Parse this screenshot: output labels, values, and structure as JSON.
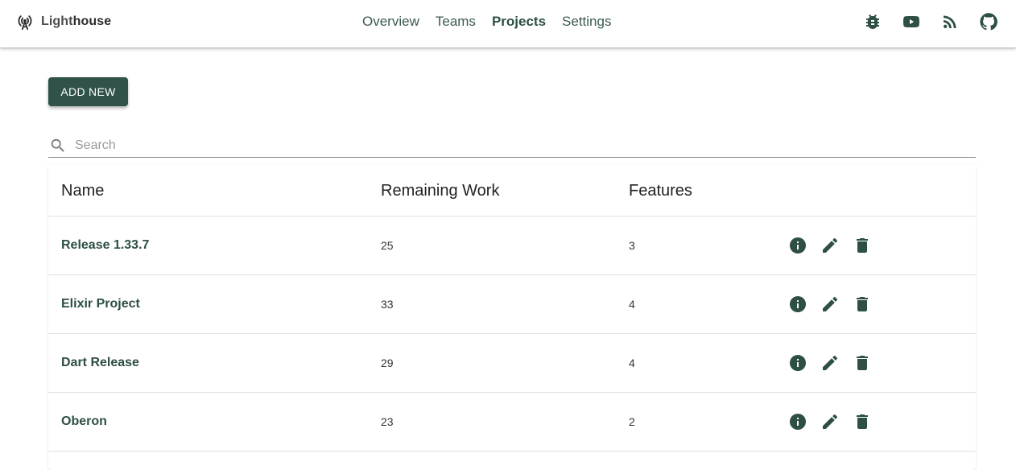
{
  "brand": {
    "name_prefix": "Light",
    "name_suffix": "house",
    "icon": "broadcast-tower-icon"
  },
  "nav": {
    "items": [
      {
        "label": "Overview",
        "active": false
      },
      {
        "label": "Teams",
        "active": false
      },
      {
        "label": "Projects",
        "active": true
      },
      {
        "label": "Settings",
        "active": false
      }
    ]
  },
  "top_icons": [
    "bug-icon",
    "youtube-icon",
    "rss-icon",
    "github-icon"
  ],
  "toolbar": {
    "add_label": "ADD NEW"
  },
  "search": {
    "placeholder": "Search",
    "value": ""
  },
  "table": {
    "headers": {
      "name": "Name",
      "remaining": "Remaining Work",
      "features": "Features"
    },
    "rows": [
      {
        "name": "Release 1.33.7",
        "remaining": "25",
        "features": "3"
      },
      {
        "name": "Elixir Project",
        "remaining": "33",
        "features": "4"
      },
      {
        "name": "Dart Release",
        "remaining": "29",
        "features": "4"
      },
      {
        "name": "Oberon",
        "remaining": "23",
        "features": "2"
      }
    ],
    "row_actions": [
      "info-icon",
      "edit-icon",
      "delete-icon"
    ]
  },
  "colors": {
    "accent": "#2f5249",
    "link": "#2d4f45"
  }
}
